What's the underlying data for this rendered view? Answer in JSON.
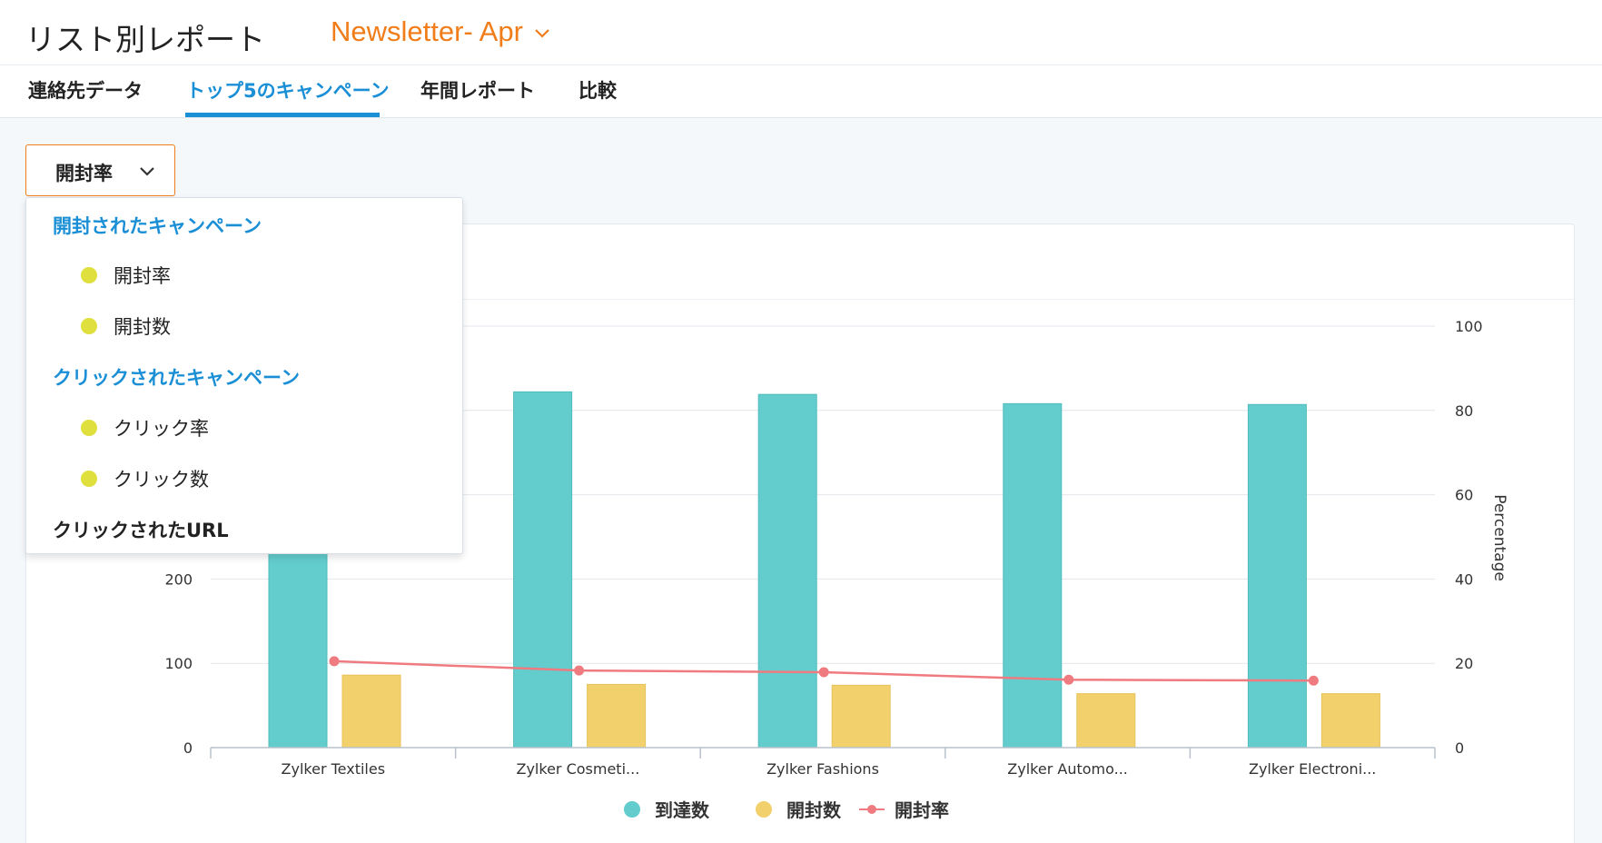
{
  "header": {
    "title": "リスト別レポート",
    "list_name": "Newsletter- Apr"
  },
  "tabs": [
    {
      "label": "連絡先データ"
    },
    {
      "label": "トップ5のキャンペーン"
    },
    {
      "label": "年間レポート"
    },
    {
      "label": "比較"
    }
  ],
  "metric_select": {
    "value": "開封率"
  },
  "menu": {
    "group1": "開封されたキャンペーン",
    "group1_items": [
      "開封率",
      "開封数"
    ],
    "group2": "クリックされたキャンペーン",
    "group2_items": [
      "クリック率",
      "クリック数"
    ],
    "plain": "クリックされたURL"
  },
  "colors": {
    "accent_orange": "#f07d19",
    "accent_blue": "#1a8fd6",
    "bar_teal": "#63cccc",
    "bar_yellow": "#f2d06b",
    "line_red": "#ef7b80",
    "menu_dot": "#dfe03d"
  },
  "chart_data": {
    "type": "bar",
    "categories": [
      "Zylker Textiles",
      "Zylker Cosmeti...",
      "Zylker Fashions",
      "Zylker Automo...",
      "Zylker Electroni..."
    ],
    "series": [
      {
        "name": "到達数",
        "type": "bar",
        "axis": "left",
        "values": [
          240,
          422,
          419,
          408,
          407
        ]
      },
      {
        "name": "開封数",
        "type": "bar",
        "axis": "left",
        "values": [
          86,
          75,
          74,
          64,
          64
        ]
      },
      {
        "name": "開封率",
        "type": "line",
        "axis": "right",
        "values": [
          20.5,
          18.3,
          17.9,
          16.1,
          15.9
        ]
      }
    ],
    "y_left": {
      "ticks": [
        0,
        100,
        200
      ],
      "ylim": [
        0,
        500
      ]
    },
    "y_right": {
      "label": "Percentage",
      "ticks": [
        0,
        20,
        40,
        60,
        80,
        100
      ],
      "ylim": [
        0,
        100
      ]
    },
    "grid": true,
    "legend_position": "bottom-center"
  }
}
